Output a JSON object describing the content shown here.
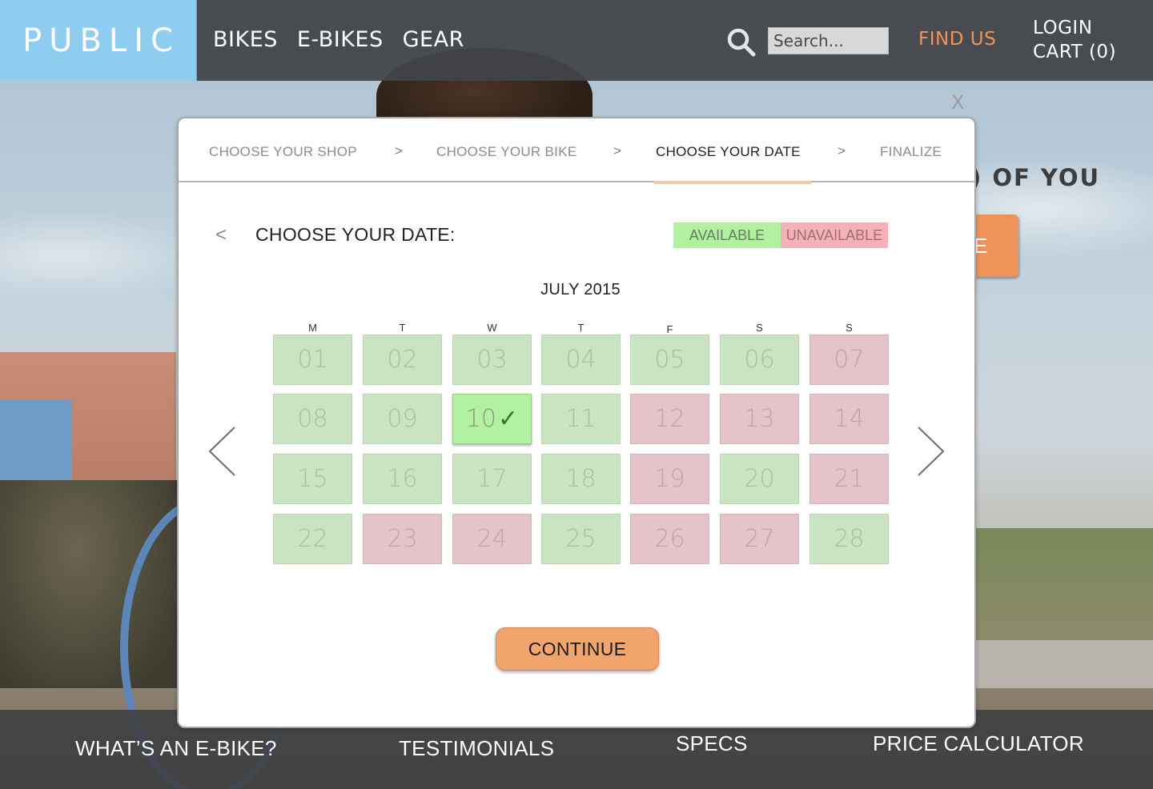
{
  "header": {
    "logo": "PUBLIC",
    "nav": [
      "BIKES",
      "E-BIKES",
      "GEAR"
    ],
    "search_placeholder": "Search...",
    "find_us": "FIND US",
    "login": "LOGIN",
    "cart": "CART (0)"
  },
  "hero": {
    "headline_fragment": ") OF YOU",
    "button_fragment": "E"
  },
  "footer_nav": [
    "WHAT’S AN E-BIKE?",
    "TESTIMONIALS",
    "SPECS",
    "PRICE CALCULATOR"
  ],
  "modal": {
    "close_label": "X",
    "steps": [
      {
        "label": "CHOOSE YOUR SHOP",
        "active": false
      },
      {
        "label": "CHOOSE YOUR BIKE",
        "active": false
      },
      {
        "label": "CHOOSE YOUR DATE",
        "active": true
      },
      {
        "label": "FINALIZE",
        "active": false
      }
    ],
    "step_separator": ">",
    "back_label": "<",
    "title": "CHOOSE YOUR DATE:",
    "legend": {
      "available": "AVAILABLE",
      "unavailable": "UNAVAILABLE"
    },
    "month": "JULY 2015",
    "weekdays": [
      "M",
      "T",
      "W",
      "T",
      "F",
      "S",
      "S"
    ],
    "days": [
      {
        "day": "01",
        "status": "available"
      },
      {
        "day": "02",
        "status": "available"
      },
      {
        "day": "03",
        "status": "available"
      },
      {
        "day": "04",
        "status": "available"
      },
      {
        "day": "05",
        "status": "available"
      },
      {
        "day": "06",
        "status": "available"
      },
      {
        "day": "07",
        "status": "unavailable"
      },
      {
        "day": "08",
        "status": "available"
      },
      {
        "day": "09",
        "status": "available"
      },
      {
        "day": "10",
        "status": "selected"
      },
      {
        "day": "11",
        "status": "available"
      },
      {
        "day": "12",
        "status": "unavailable"
      },
      {
        "day": "13",
        "status": "unavailable"
      },
      {
        "day": "14",
        "status": "unavailable"
      },
      {
        "day": "15",
        "status": "available"
      },
      {
        "day": "16",
        "status": "available"
      },
      {
        "day": "17",
        "status": "available"
      },
      {
        "day": "18",
        "status": "available"
      },
      {
        "day": "19",
        "status": "unavailable"
      },
      {
        "day": "20",
        "status": "available"
      },
      {
        "day": "21",
        "status": "unavailable"
      },
      {
        "day": "22",
        "status": "available"
      },
      {
        "day": "23",
        "status": "unavailable"
      },
      {
        "day": "24",
        "status": "unavailable"
      },
      {
        "day": "25",
        "status": "available"
      },
      {
        "day": "26",
        "status": "unavailable"
      },
      {
        "day": "27",
        "status": "unavailable"
      },
      {
        "day": "28",
        "status": "available"
      }
    ],
    "selected_check": "✓",
    "continue_label": "CONTINUE"
  },
  "colors": {
    "accent_orange": "#f0935a",
    "logo_blue": "#8ecdf0",
    "available_green": "#b2f1a1",
    "unavailable_red": "#f2b2b6"
  }
}
